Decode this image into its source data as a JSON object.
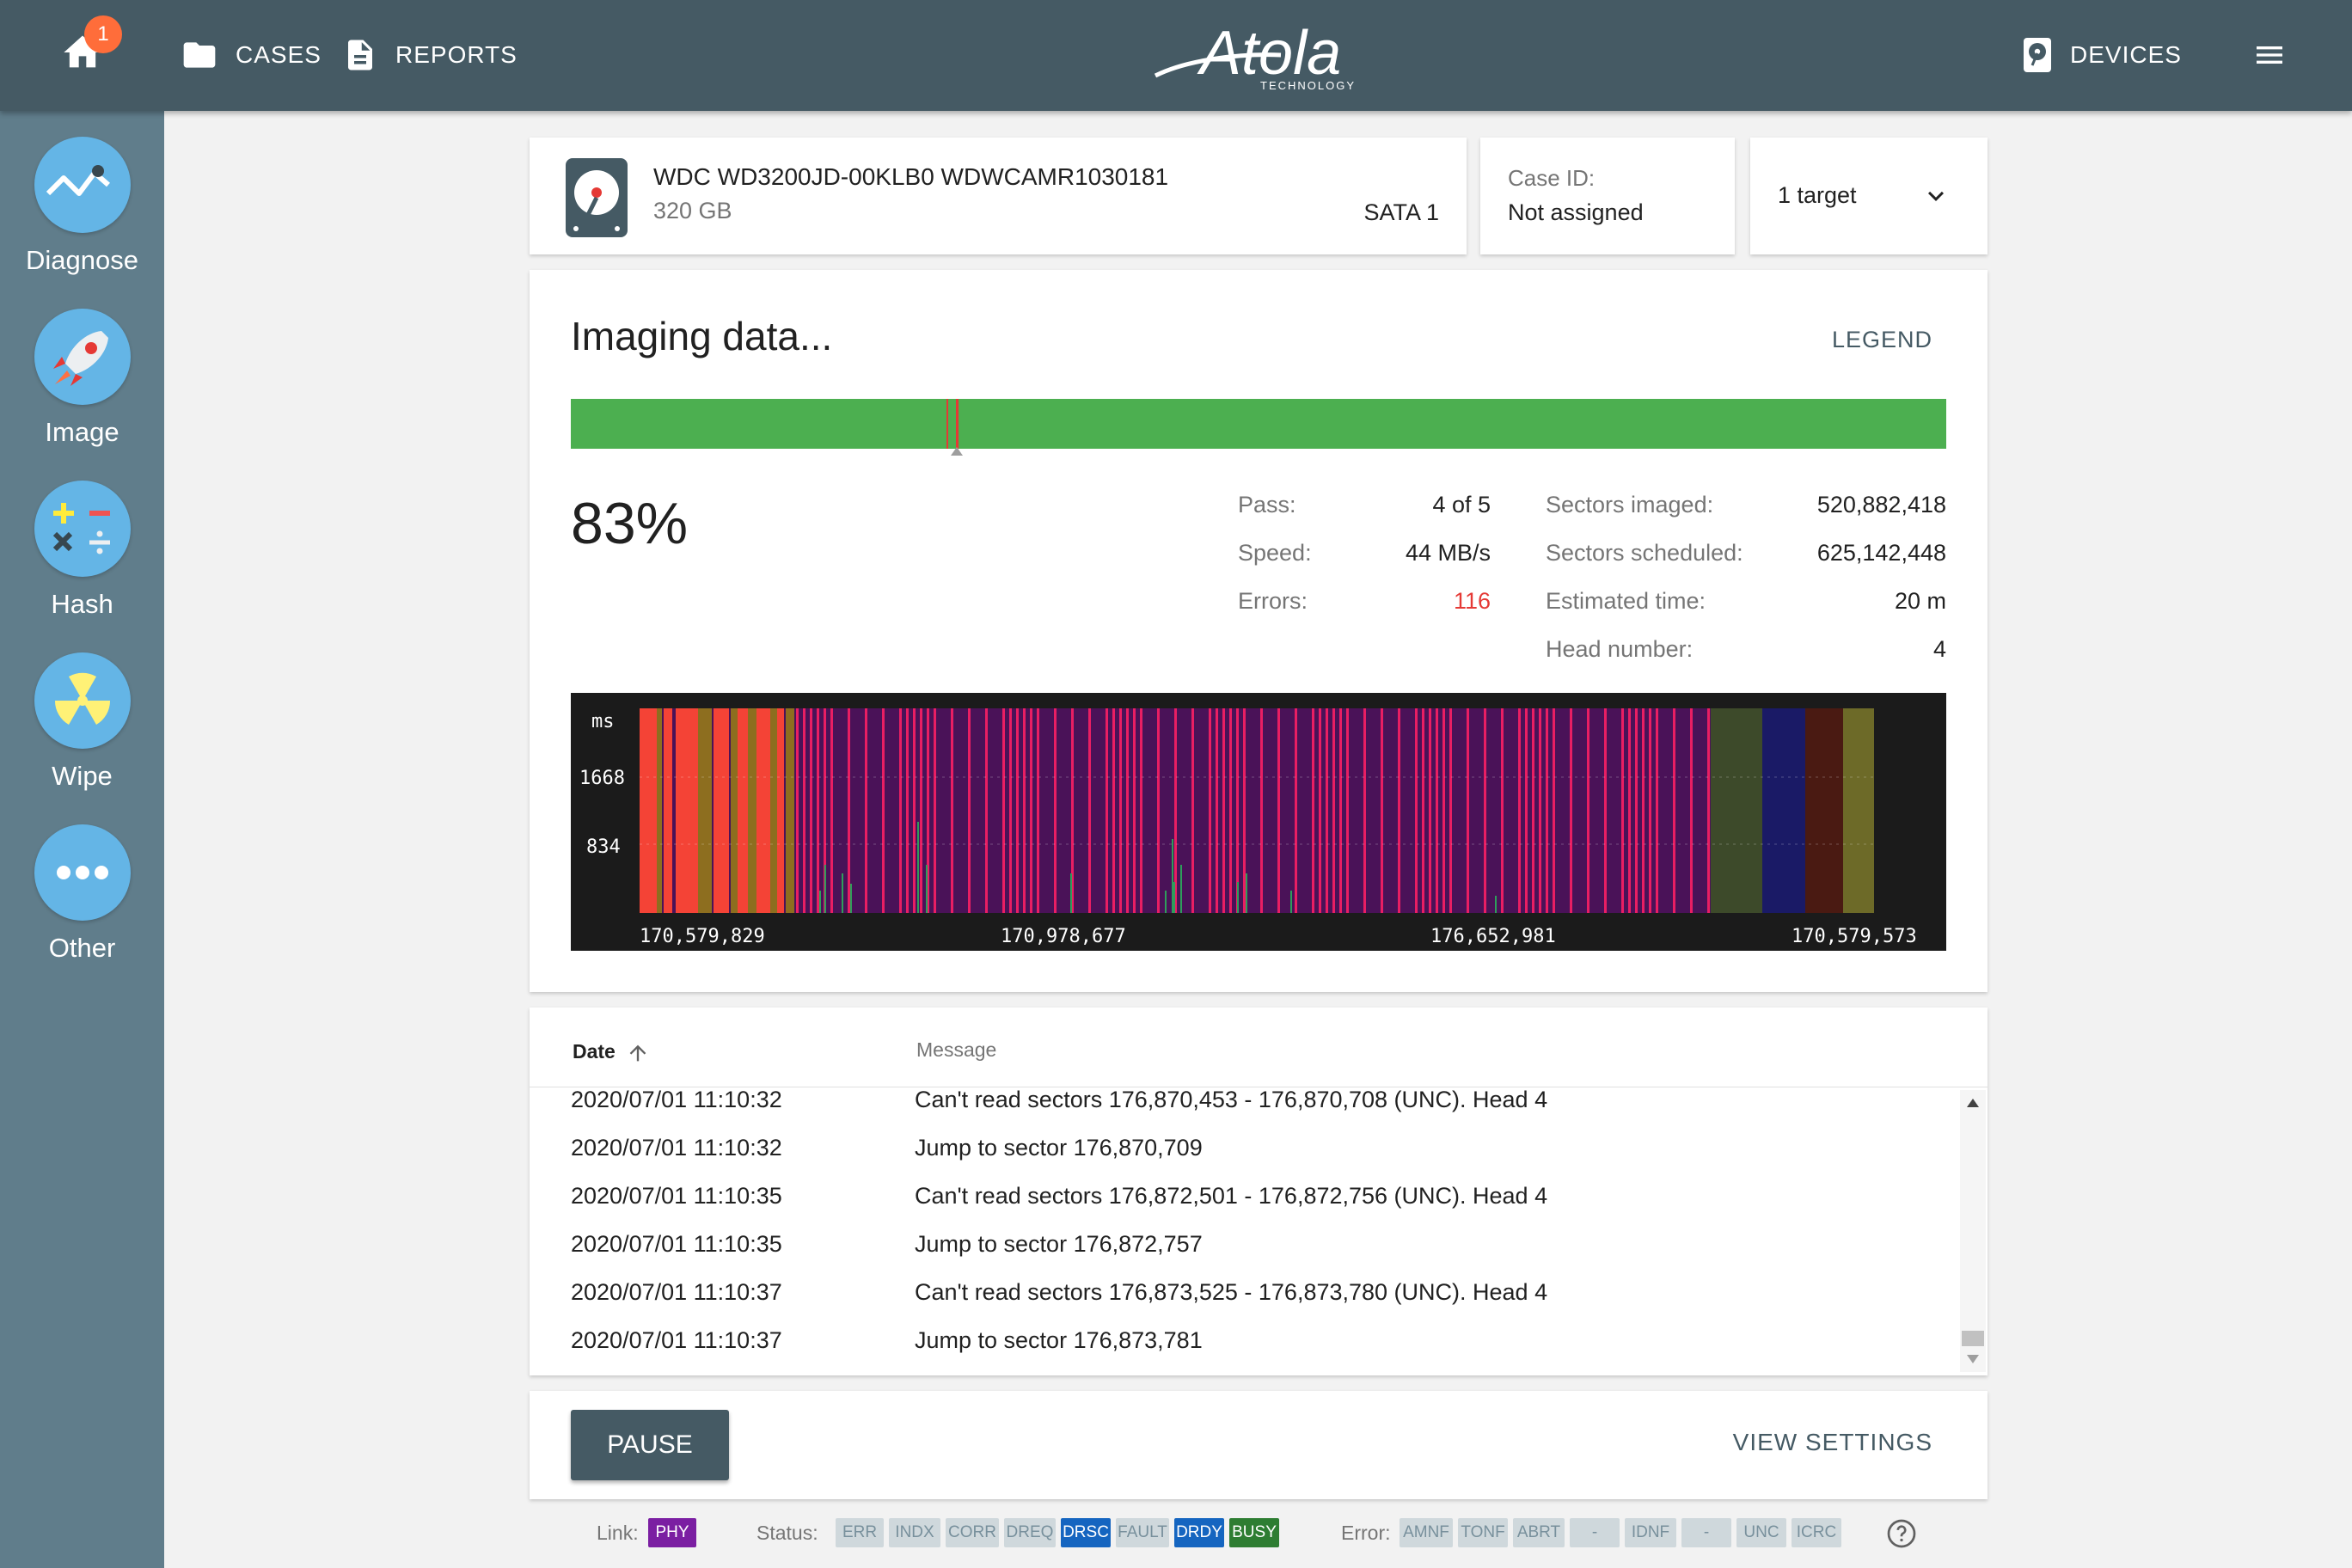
{
  "topbar": {
    "home_badge": "1",
    "cases_label": "CASES",
    "reports_label": "REPORTS",
    "logo_text": "Atola",
    "logo_sub": "TECHNOLOGY",
    "devices_label": "DEVICES"
  },
  "sidebar": {
    "items": [
      {
        "label": "Diagnose",
        "icon": "diagnose-icon"
      },
      {
        "label": "Image",
        "icon": "rocket-icon"
      },
      {
        "label": "Hash",
        "icon": "calculator-icon"
      },
      {
        "label": "Wipe",
        "icon": "radiation-icon"
      },
      {
        "label": "Other",
        "icon": "more-dots-icon"
      }
    ]
  },
  "drive": {
    "model": "WDC WD3200JD-00KLB0 WDWCAMR1030181",
    "capacity": "320 GB",
    "port": "SATA 1"
  },
  "case": {
    "label": "Case ID:",
    "value": "Not assigned"
  },
  "target": {
    "value": "1 target"
  },
  "imaging": {
    "title": "Imaging data...",
    "legend_label": "LEGEND",
    "progress_percent": "83%",
    "progress_fraction": 0.83,
    "stats_left": [
      {
        "label": "Pass:",
        "value": "4 of 5"
      },
      {
        "label": "Speed:",
        "value": "44 MB/s"
      },
      {
        "label": "Errors:",
        "value": "116"
      }
    ],
    "stats_right": [
      {
        "label": "Sectors imaged:",
        "value": "520,882,418"
      },
      {
        "label": "Sectors scheduled:",
        "value": "625,142,448"
      },
      {
        "label": "Estimated time:",
        "value": "20 m"
      },
      {
        "label": "Head number:",
        "value": "4"
      }
    ],
    "colors": {
      "progress": "#4caf50",
      "error": "#e53935"
    }
  },
  "chart_data": {
    "type": "bar",
    "ylabel": "ms",
    "yticks": [
      "1668",
      "834"
    ],
    "xticks": [
      "170,579,829",
      "170,978,677",
      "176,652,981",
      "170,579,573"
    ]
  },
  "log": {
    "columns": [
      "Date",
      "Message"
    ],
    "rows": [
      {
        "date": "2020/07/01 11:10:32",
        "message": "Can't read sectors 176,870,453 - 176,870,708 (UNC). Head 4"
      },
      {
        "date": "2020/07/01 11:10:32",
        "message": "Jump to sector 176,870,709"
      },
      {
        "date": "2020/07/01 11:10:35",
        "message": "Can't read sectors 176,872,501 - 176,872,756 (UNC). Head 4"
      },
      {
        "date": "2020/07/01 11:10:35",
        "message": "Jump to sector 176,872,757"
      },
      {
        "date": "2020/07/01 11:10:37",
        "message": "Can't read sectors 176,873,525 - 176,873,780 (UNC). Head 4"
      },
      {
        "date": "2020/07/01 11:10:37",
        "message": "Jump to sector 176,873,781"
      }
    ]
  },
  "actions": {
    "pause_label": "PAUSE",
    "view_settings_label": "VIEW SETTINGS"
  },
  "statusbar": {
    "link_label": "Link:",
    "link_chip": "PHY",
    "status_label": "Status:",
    "status_chips": [
      "ERR",
      "INDX",
      "CORR",
      "DREQ",
      "DRSC",
      "FAULT",
      "DRDY",
      "BUSY"
    ],
    "error_label": "Error:",
    "error_chips": [
      "AMNF",
      "TONF",
      "ABRT",
      "-",
      "IDNF",
      "-",
      "UNC",
      "ICRC"
    ]
  }
}
